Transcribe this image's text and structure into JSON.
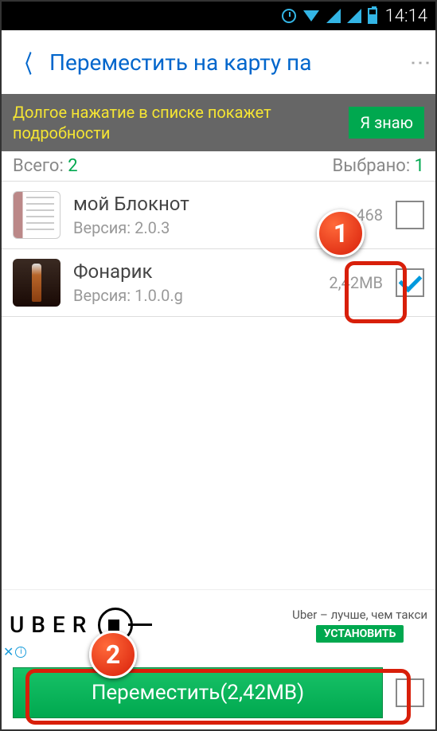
{
  "status": {
    "time": "14:14"
  },
  "header": {
    "title": "Переместить на карту па"
  },
  "hint": {
    "text": "Долгое нажатие в списке покажет подробности",
    "button": "Я знаю"
  },
  "counts": {
    "total_label": "Всего:",
    "total": "2",
    "selected_label": "Выбрано:",
    "selected": "1"
  },
  "apps": [
    {
      "name": "мой Блокнот",
      "version_label": "Версия: 2.0.3",
      "size": "468",
      "checked": false
    },
    {
      "name": "Фонарик",
      "version_label": "Версия: 1.0.0.g",
      "size": "2,42MB",
      "checked": true
    }
  ],
  "ad": {
    "logo": "U B E R",
    "text": "Uber – лучше, чем такси",
    "cta": "УСТАНОВИТЬ"
  },
  "action": {
    "label": "Переместить(2,42MB)"
  },
  "markers": {
    "one": "1",
    "two": "2"
  }
}
